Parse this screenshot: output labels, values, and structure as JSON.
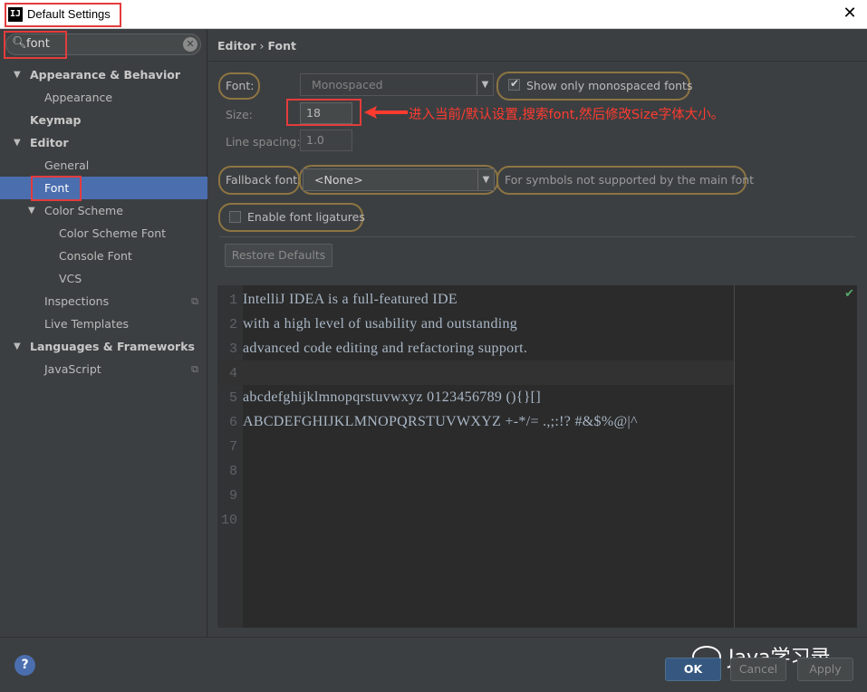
{
  "window": {
    "title": "Default Settings",
    "app_icon": "IJ"
  },
  "sidebar": {
    "search_value": "font",
    "items": [
      {
        "label": "Appearance & Behavior",
        "level": 0,
        "bold": true,
        "expanded": true
      },
      {
        "label": "Appearance",
        "level": 1
      },
      {
        "label": "Keymap",
        "level": 0,
        "bold": true
      },
      {
        "label": "Editor",
        "level": 0,
        "bold": true,
        "expanded": true
      },
      {
        "label": "General",
        "level": 1
      },
      {
        "label": "Font",
        "level": 1,
        "selected": true
      },
      {
        "label": "Color Scheme",
        "level": 1,
        "expanded": true
      },
      {
        "label": "Color Scheme Font",
        "level": 2
      },
      {
        "label": "Console Font",
        "level": 2
      },
      {
        "label": "VCS",
        "level": 2
      },
      {
        "label": "Inspections",
        "level": 1,
        "project_icon": true
      },
      {
        "label": "Live Templates",
        "level": 1
      },
      {
        "label": "Languages & Frameworks",
        "level": 0,
        "bold": true,
        "expanded": true
      },
      {
        "label": "JavaScript",
        "level": 1,
        "project_icon": true
      }
    ]
  },
  "main": {
    "breadcrumb": [
      "Editor",
      "Font"
    ],
    "font_label": "Font:",
    "font_value": "Monospaced",
    "show_monospaced_label": "Show only monospaced fonts",
    "show_monospaced_checked": true,
    "size_label": "Size:",
    "size_value": "18",
    "line_spacing_label": "Line spacing:",
    "line_spacing_value": "1.0",
    "fallback_label": "Fallback font:",
    "fallback_value": "<None>",
    "fallback_hint": "For symbols not supported by the main font",
    "ligatures_label": "Enable font ligatures",
    "ligatures_checked": false,
    "restore_label": "Restore Defaults",
    "annotation": "进入当前/默认设置,搜索font,然后修改Size字体大小。"
  },
  "preview": {
    "lines": [
      "IntelliJ IDEA is a full-featured IDE",
      "with a high level of usability and outstanding",
      "advanced code editing and refactoring support.",
      "",
      "abcdefghijklmnopqrstuvwxyz 0123456789 (){}[]",
      "ABCDEFGHIJKLMNOPQRSTUVWXYZ +-*/= .,;:!? #&$%@|^",
      "",
      "",
      "",
      ""
    ],
    "line_numbers": [
      "1",
      "2",
      "3",
      "4",
      "5",
      "6",
      "7",
      "8",
      "9",
      "10"
    ]
  },
  "footer": {
    "ok_label": "OK",
    "cancel_label": "Cancel",
    "apply_label": "Apply",
    "help_label": "?",
    "watermark": "Java学习录"
  },
  "colors": {
    "selection": "#4b6eaf",
    "highlight_box": "#e33c3c",
    "annotation": "#ff3b30",
    "oval": "#8d7542"
  },
  "icons": [
    "app-icon",
    "close-icon",
    "search-icon",
    "clear-search-icon",
    "expand-arrow-icon",
    "project-scope-icon",
    "dropdown-arrow-icon",
    "checkmark-icon",
    "help-icon",
    "wechat-icon"
  ]
}
